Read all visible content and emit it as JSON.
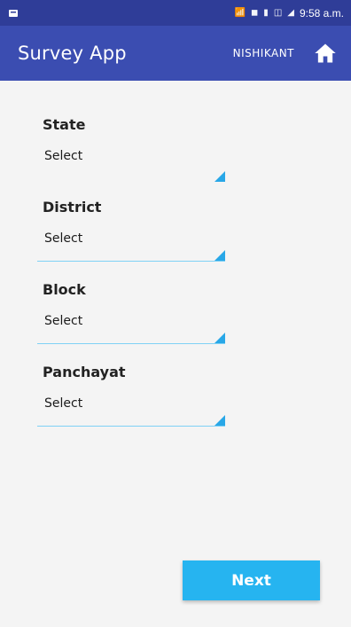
{
  "status_bar": {
    "icons": [
      "notification-icon",
      "wifi-icon",
      "volte-icon",
      "battery-icon",
      "lte-icon",
      "signal-icon"
    ],
    "time": "9:58 a.m."
  },
  "app_bar": {
    "title": "Survey App",
    "username": "NISHIKANT",
    "home_icon": "home-icon"
  },
  "form": {
    "fields": [
      {
        "label": "State",
        "value": "Select"
      },
      {
        "label": "District",
        "value": "Select"
      },
      {
        "label": "Block",
        "value": "Select"
      },
      {
        "label": "Panchayat",
        "value": "Select"
      }
    ],
    "next_label": "Next"
  },
  "colors": {
    "statusbar": "#2f3d98",
    "appbar": "#3b4db1",
    "accent": "#26b4f0"
  }
}
